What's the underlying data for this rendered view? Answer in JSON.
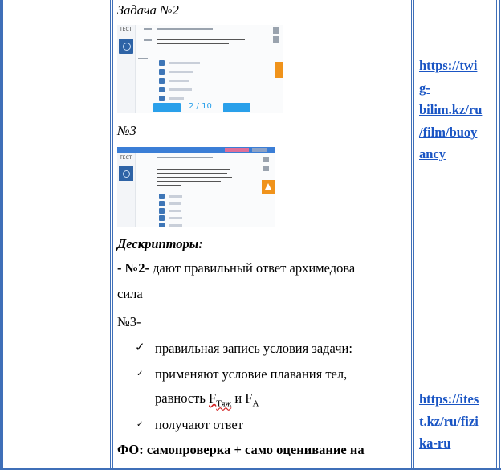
{
  "task2": {
    "heading": "Задача №2"
  },
  "screenshot2": {
    "logo_text": "ТЕСТ",
    "counter": "2 / 10",
    "colors": {
      "panel_blue": "#2e63a6",
      "orange": "#f0931b",
      "button_blue": "#2aa0ea"
    }
  },
  "task3": {
    "heading": "№3"
  },
  "screenshot3": {
    "logo_text": "ТЕСТ",
    "colors": {
      "topbar_blue": "#3b7ed6",
      "pink": "#e06f99",
      "orange": "#f0931b"
    }
  },
  "descriptors": {
    "title": "Дескрипторы:",
    "line1_prefix": "- ",
    "line1_bold": "№2-",
    "line1_text": " дают правильный ответ архимедова",
    "line2": "сила",
    "line3": "№3-",
    "check1": "правильная запись условия задачи:",
    "check2a": "применяют условие плавания тел,",
    "check2b": "равность ",
    "check2_fa": "F",
    "check2_sub1": "Тяж",
    "check2_and": " и F",
    "check2_sub2": "A",
    "check3": "получают ответ",
    "footer": "ФО: самопроверка + само оценивание на"
  },
  "links": {
    "link1": [
      "https://twi",
      "g-",
      "bilim.kz/ru",
      "/film/buoy",
      "ancy"
    ],
    "link2": [
      "https://ites",
      "t.kz/ru/fizi",
      "ka-ru"
    ]
  }
}
